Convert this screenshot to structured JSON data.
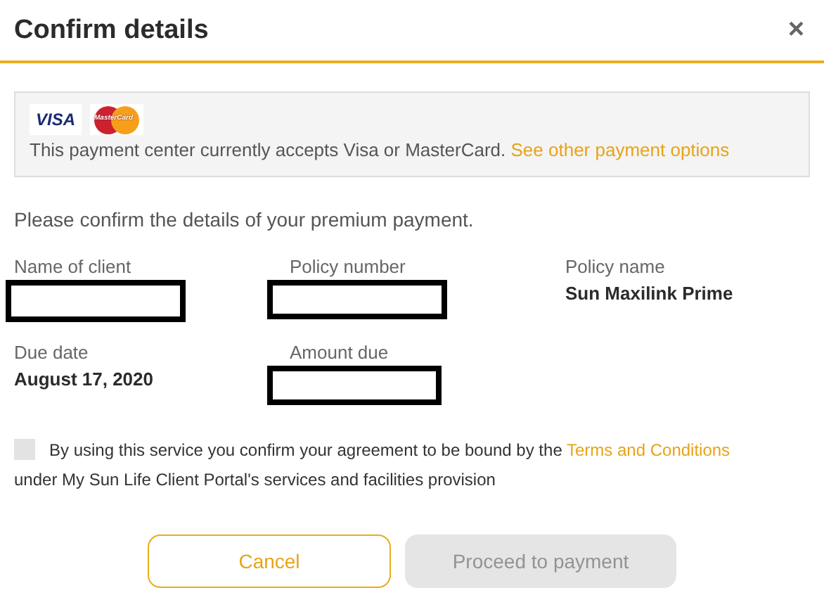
{
  "dialog": {
    "title": "Confirm details",
    "close": "×"
  },
  "notice": {
    "card_logos": [
      {
        "kind": "visa",
        "label": "VISA"
      },
      {
        "kind": "mastercard",
        "label": "MasterCard"
      }
    ],
    "text": "This payment center currently accepts Visa or MasterCard.",
    "link": "See other payment options"
  },
  "intro": "Please confirm the details of your premium payment.",
  "fields": [
    {
      "label": "Name of client",
      "redacted": true
    },
    {
      "label": "Policy number",
      "redacted": true
    },
    {
      "label": "Policy name",
      "value": "Sun Maxilink Prime",
      "redacted": false
    },
    {
      "label": "Due date",
      "value": "August 17, 2020",
      "redacted": false
    },
    {
      "label": "Amount due",
      "redacted": true
    }
  ],
  "agreement": {
    "checked": false,
    "text": "By using this service you confirm your agreement to be bound by the",
    "link": "Terms and Conditions",
    "text_after": "under My Sun Life Client Portal's services and facilities provision"
  },
  "buttons": [
    {
      "label": "Cancel",
      "kind": "secondary",
      "disabled": false
    },
    {
      "label": "Proceed to payment",
      "kind": "primary",
      "disabled": true
    }
  ]
}
